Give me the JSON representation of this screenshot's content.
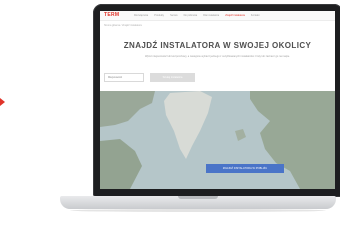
{
  "header": {
    "logo": "TERM",
    "nav": [
      "Rozwiązania",
      "Produkty",
      "Serwis",
      "Do pobrania",
      "Dla instalatora",
      "Znajdź instalatora",
      "Kontakt"
    ],
    "active_index": 5
  },
  "breadcrumb": "Strona główna / Znajdź instalatora",
  "hero": {
    "title": "ZNAJDŹ INSTALATORA W SWOJEJ OKOLICY",
    "description": "Wpisz miejscowość lub kod pocztowy, a następnie wybierz jednego z certyfikowanych instalatorów z listy lub zaznacz go na mapie."
  },
  "search": {
    "placeholder": "Miejscowość",
    "button": "Szukaj instalatora"
  },
  "map": {
    "cta": "ZNAJDŹ INSTALATORA W POBLIŻU"
  },
  "colors": {
    "brand": "#e0342a",
    "cta": "#4a74c8",
    "water": "#b5c6c9",
    "land": "#9aa899"
  }
}
